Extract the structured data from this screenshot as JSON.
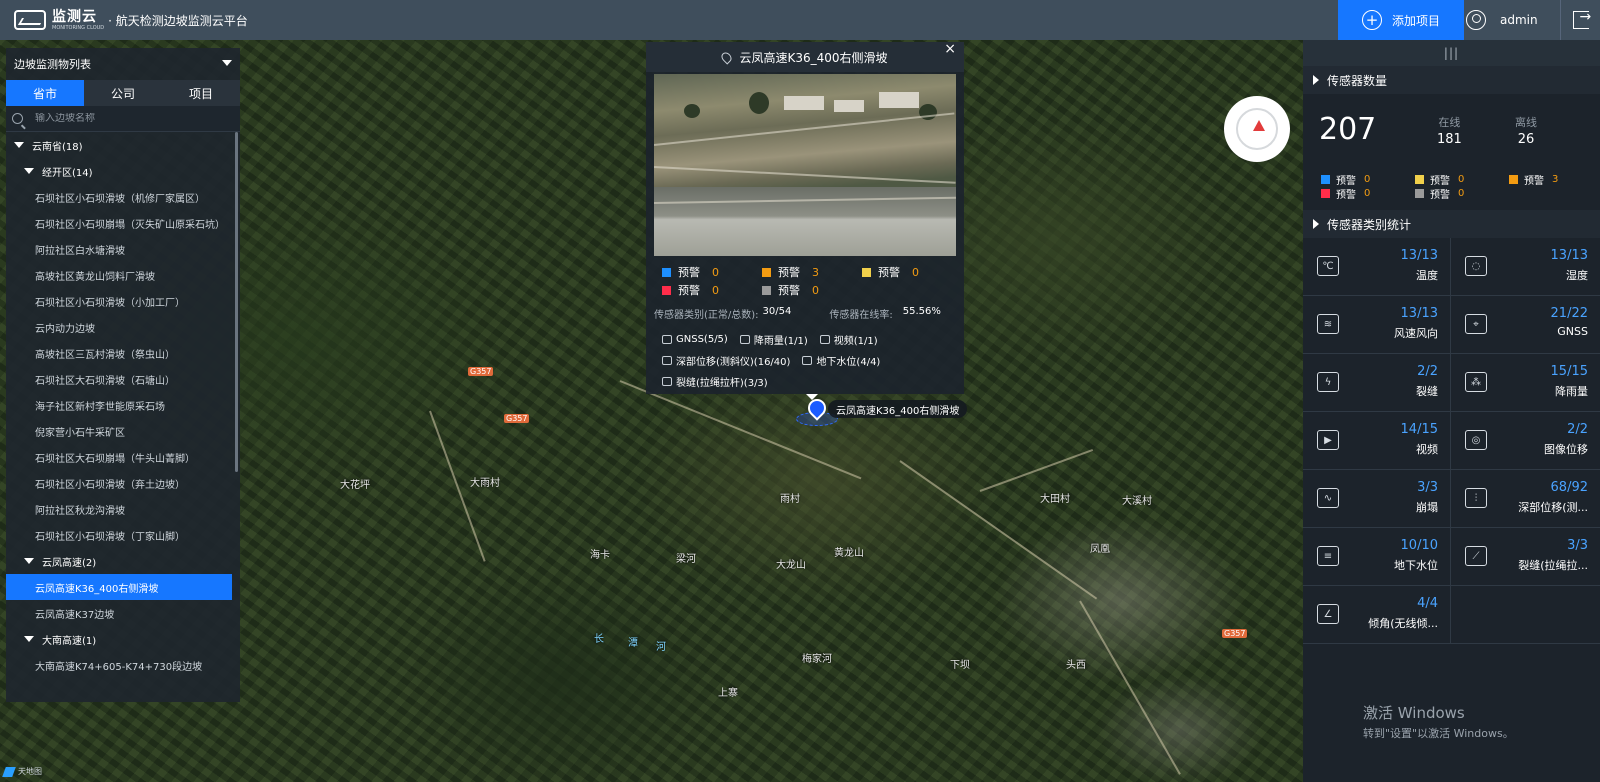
{
  "header": {
    "logo_cn": "监测云",
    "logo_en": "MONITORING CLOUD",
    "title": "· 航天检测边坡监测云平台",
    "add_project": "添加项目",
    "user": "admin"
  },
  "left_panel": {
    "title": "边坡监测物列表",
    "tabs": [
      "省市",
      "公司",
      "项目"
    ],
    "search_placeholder": "输入边坡名称",
    "tree": [
      {
        "level": 0,
        "label": "云南省(18)",
        "expanded": true
      },
      {
        "level": 1,
        "label": "经开区(14)",
        "expanded": true
      },
      {
        "level": 2,
        "label": "石坝社区小石坝滑坡（机修厂家属区）"
      },
      {
        "level": 2,
        "label": "石坝社区小石坝崩塌（灭失矿山原采石坑）"
      },
      {
        "level": 2,
        "label": "阿拉社区白水塘滑坡"
      },
      {
        "level": 2,
        "label": "高坡社区黄龙山饲料厂滑坡"
      },
      {
        "level": 2,
        "label": "石坝社区小石坝滑坡（小加工厂）"
      },
      {
        "level": 2,
        "label": "云内动力边坡"
      },
      {
        "level": 2,
        "label": "高坡社区三瓦村滑坡（祭虫山）"
      },
      {
        "level": 2,
        "label": "石坝社区大石坝滑坡（石塘山）"
      },
      {
        "level": 2,
        "label": "海子社区新村李世能原采石场"
      },
      {
        "level": 2,
        "label": "倪家营小石牛采矿区"
      },
      {
        "level": 2,
        "label": "石坝社区大石坝崩塌（牛头山菁脚）"
      },
      {
        "level": 2,
        "label": "石坝社区小石坝滑坡（弃土边坡）"
      },
      {
        "level": 2,
        "label": "阿拉社区秋龙沟滑坡"
      },
      {
        "level": 2,
        "label": "石坝社区小石坝滑坡（丁家山脚）"
      },
      {
        "level": 1,
        "label": "云凤高速(2)",
        "expanded": true
      },
      {
        "level": 2,
        "label": "云凤高速K36_400右侧滑坡",
        "selected": true
      },
      {
        "level": 2,
        "label": "云凤高速K37边坡"
      },
      {
        "level": 1,
        "label": "大南高速(1)",
        "expanded": true
      },
      {
        "level": 2,
        "label": "大南高速K74+605-K74+730段边坡"
      }
    ]
  },
  "popup": {
    "title": "云凤高速K36_400右侧滑坡",
    "close": "×",
    "warnings": [
      {
        "label": "预警",
        "count": "0",
        "color": "#1e90ff"
      },
      {
        "label": "预警",
        "count": "3",
        "color": "#f39c12"
      },
      {
        "label": "预警",
        "count": "0",
        "color": "#f1d04b"
      },
      {
        "label": "预警",
        "count": "0",
        "color": "#ff2d4a"
      },
      {
        "label": "预警",
        "count": "0",
        "color": "#9a9a9a"
      }
    ],
    "type_label": "传感器类别(正常/总数):",
    "type_value": "30/54",
    "rate_label": "传感器在线率:",
    "rate_value": "55.56%",
    "sensors": [
      [
        "GNSS(5/5)",
        "降雨量(1/1)",
        "视频(1/1)"
      ],
      [
        "深部位移(测斜仪)(16/40)",
        "地下水位(4/4)"
      ],
      [
        "裂缝(拉绳拉杆)(3/3)"
      ]
    ]
  },
  "marker_label": "云凤高速K36_400右侧滑坡",
  "map_labels": [
    {
      "text": "大花坪"
    },
    {
      "text": "大雨村"
    },
    {
      "text": "雨村"
    },
    {
      "text": "大田村"
    },
    {
      "text": "海卡"
    },
    {
      "text": "梁河"
    },
    {
      "text": "大龙山"
    },
    {
      "text": "黄龙山"
    },
    {
      "text": "梅家河"
    },
    {
      "text": "头西"
    },
    {
      "text": "上寨"
    },
    {
      "text": "大溪村"
    },
    {
      "text": "长"
    },
    {
      "text": "潭"
    },
    {
      "text": "河"
    },
    {
      "text": "凤凰"
    },
    {
      "text": "下坝"
    },
    {
      "text": "G357"
    },
    {
      "text": "G357"
    },
    {
      "text": "G357"
    }
  ],
  "right_panel": {
    "handle": "|||",
    "sensor_count_title": "传感器数量",
    "total": "207",
    "online_label": "在线",
    "online": "181",
    "offline_label": "离线",
    "offline": "26",
    "warnings": [
      {
        "label": "预警",
        "count": "0",
        "color": "#1e90ff"
      },
      {
        "label": "预警",
        "count": "0",
        "color": "#f1d04b"
      },
      {
        "label": "预警",
        "count": "3",
        "color": "#f39c12"
      },
      {
        "label": "预警",
        "count": "0",
        "color": "#ff2d4a"
      },
      {
        "label": "预警",
        "count": "0",
        "color": "#9a9a9a"
      }
    ],
    "category_title": "传感器类别统计",
    "categories": [
      {
        "value": "13/13",
        "name": "温度",
        "icon": "thermometer-icon"
      },
      {
        "value": "13/13",
        "name": "湿度",
        "icon": "humidity-icon"
      },
      {
        "value": "13/13",
        "name": "风速风向",
        "icon": "wind-icon"
      },
      {
        "value": "21/22",
        "name": "GNSS",
        "icon": "gnss-icon"
      },
      {
        "value": "2/2",
        "name": "裂缝",
        "icon": "crack-icon"
      },
      {
        "value": "15/15",
        "name": "降雨量",
        "icon": "rainfall-icon"
      },
      {
        "value": "14/15",
        "name": "视频",
        "icon": "video-icon"
      },
      {
        "value": "2/2",
        "name": "图像位移",
        "icon": "camera-icon"
      },
      {
        "value": "3/3",
        "name": "崩塌",
        "icon": "collapse-icon"
      },
      {
        "value": "68/92",
        "name": "深部位移(测...",
        "icon": "deep-displacement-icon"
      },
      {
        "value": "10/10",
        "name": "地下水位",
        "icon": "groundwater-icon"
      },
      {
        "value": "3/3",
        "name": "裂缝(拉绳拉...",
        "icon": "rope-crack-icon"
      },
      {
        "value": "4/4",
        "name": "倾角(无线倾...",
        "icon": "tilt-icon"
      }
    ]
  },
  "watermark": {
    "line1": "激活 Windows",
    "line2": "转到\"设置\"以激活 Windows。"
  },
  "bottom_logo": "天地图"
}
